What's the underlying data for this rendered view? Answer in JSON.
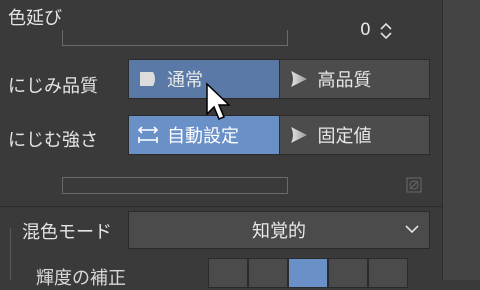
{
  "color_stretch": {
    "label": "色延び",
    "value": "0"
  },
  "bleed_quality": {
    "label": "にじみ品質",
    "options": [
      {
        "label": "通常",
        "selected": true
      },
      {
        "label": "高品質",
        "selected": false
      }
    ]
  },
  "bleed_strength": {
    "label": "にじむ強さ",
    "options": [
      {
        "label": "自動設定",
        "selected": true
      },
      {
        "label": "固定値",
        "selected": false
      }
    ]
  },
  "color_mix_mode": {
    "label": "混色モード",
    "selected": "知覚的"
  },
  "brightness_correction": {
    "label": "輝度の補正"
  },
  "colors": {
    "panel_bg": "#3a3a3a",
    "selected": "#6a90c8",
    "button_bg": "#4b4b4b"
  }
}
